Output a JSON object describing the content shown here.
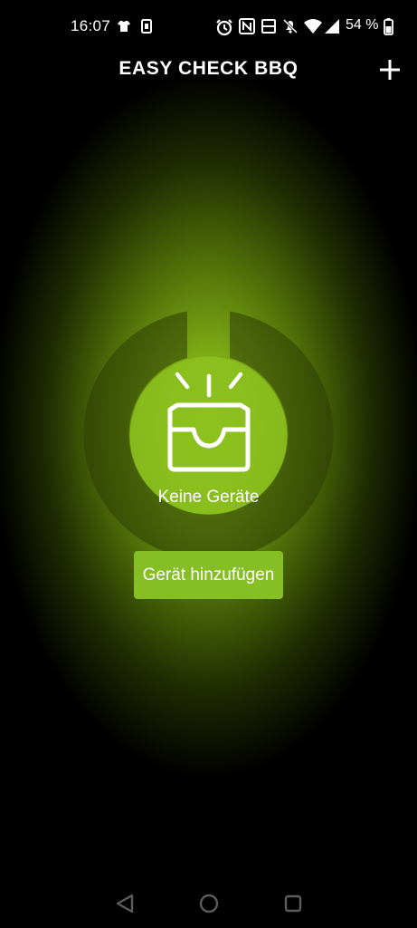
{
  "status_bar": {
    "time": "16:07",
    "battery_text": "54 %",
    "icons": [
      "tshirt-icon",
      "sim-icon",
      "alarm-icon",
      "nfc-icon",
      "volte-icon",
      "mute-icon",
      "wifi-icon",
      "signal-icon",
      "battery-icon"
    ]
  },
  "header": {
    "title": "EASY CHECK BBQ",
    "add_icon": "plus-icon"
  },
  "main": {
    "empty_icon": "inbox-icon",
    "empty_text": "Keine Geräte",
    "add_device_label": "Gerät hinzufügen"
  },
  "nav": {
    "icons": [
      "back-icon",
      "home-icon",
      "recents-icon"
    ]
  },
  "colors": {
    "accent": "#86bf24",
    "glow": "#8fc21f",
    "background": "#000000"
  }
}
